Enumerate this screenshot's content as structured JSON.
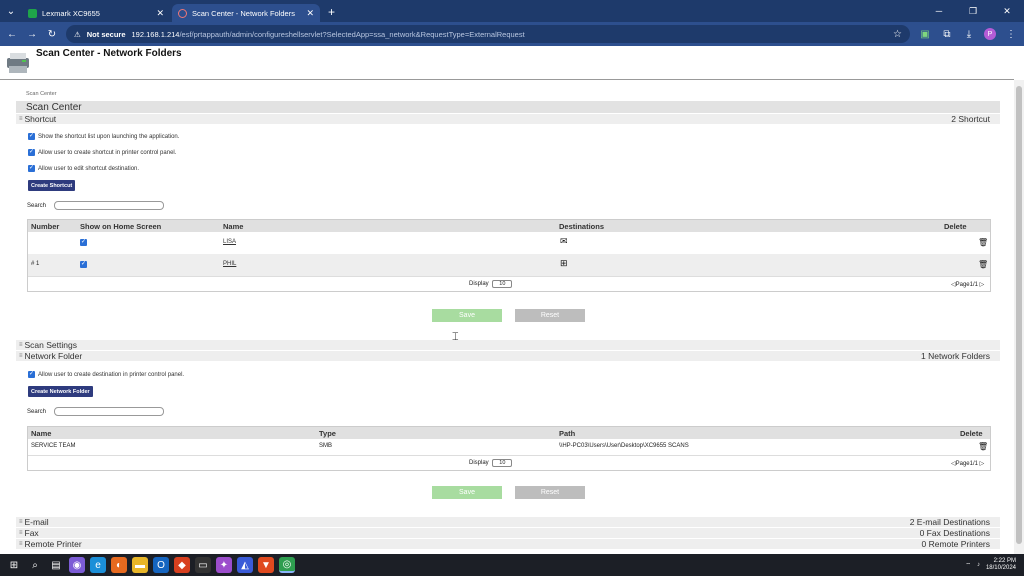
{
  "browser": {
    "tabs": [
      {
        "title": "Lexmark XC9655",
        "active": false
      },
      {
        "title": "Scan Center - Network Folders",
        "active": true
      }
    ],
    "security_label": "Not secure",
    "url_host": "192.168.1.214",
    "url_path": "/esf/prtappauth/admin/configureshellservlet?SelectedApp=ssa_network&RequestType=ExternalRequest",
    "profile_initial": "P"
  },
  "page": {
    "title": "Scan Center - Network Folders",
    "breadcrumb": "Scan Center",
    "section_title": "Scan Center"
  },
  "shortcut": {
    "label": "Shortcut",
    "count": "2 Shortcut",
    "options": [
      "Show the shortcut list upon launching the application.",
      "Allow user to create shortcut in printer control panel.",
      "Allow user to edit shortcut destination."
    ],
    "create_button": "Create Shortcut",
    "search_label": "Search",
    "columns": [
      "Number",
      "Show on Home Screen",
      "Name",
      "Destinations",
      "Delete"
    ],
    "rows": [
      {
        "number": "",
        "name": "LISA"
      },
      {
        "number": "# 1",
        "name": "PHIL"
      }
    ],
    "display_label": "Display",
    "display_value": "10",
    "pager": "Page1/1",
    "save_label": "Save",
    "reset_label": "Reset"
  },
  "scan_settings": {
    "label": "Scan Settings"
  },
  "network_folder": {
    "label": "Network Folder",
    "count": "1 Network Folders",
    "option": "Allow user to create destination in printer control panel.",
    "create_button": "Create Network Folder",
    "search_label": "Search",
    "columns": [
      "Name",
      "Type",
      "Path",
      "Delete"
    ],
    "rows": [
      {
        "name": "SERVICE TEAM",
        "type": "SMB",
        "path": "\\\\HP-PC03\\Users\\User\\Desktop\\XC9655 SCANS"
      }
    ],
    "display_label": "Display",
    "display_value": "10",
    "pager": "Page1/1",
    "save_label": "Save",
    "reset_label": "Reset"
  },
  "collapsed_sections": [
    {
      "label": "E-mail",
      "count": "2 E-mail Destinations"
    },
    {
      "label": "Fax",
      "count": "0 Fax Destinations"
    },
    {
      "label": "Remote Printer",
      "count": "0 Remote Printers"
    }
  ],
  "taskbar": {
    "time": "2:22 PM",
    "date": "18/10/2024"
  }
}
